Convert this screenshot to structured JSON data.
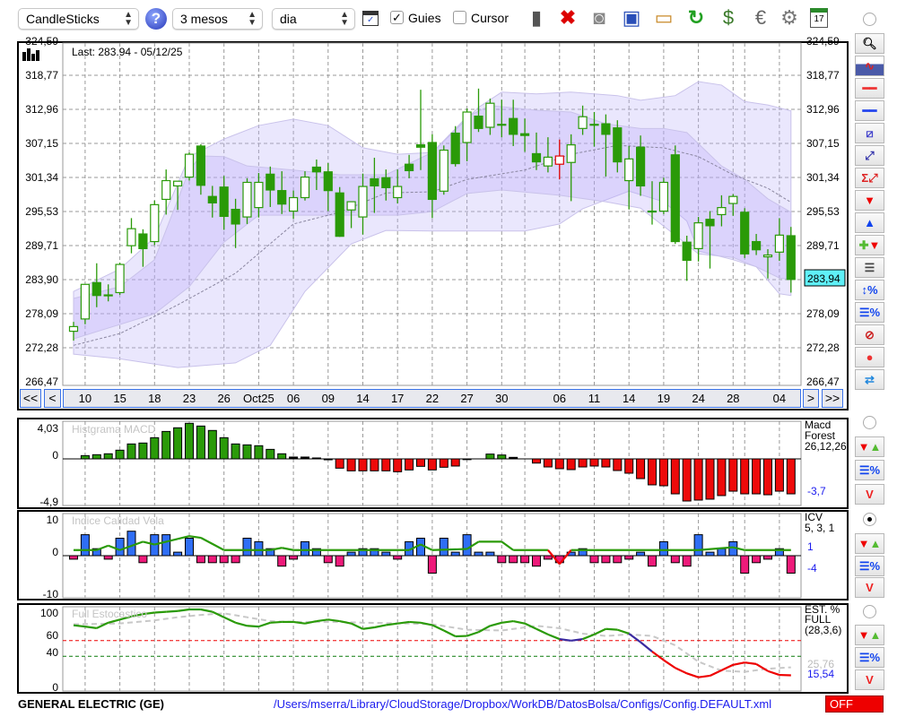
{
  "toolbar": {
    "chart_type": "CandleSticks",
    "period": "3 mesos",
    "interval": "dia",
    "guides_label": "Guies",
    "guides_checked": true,
    "cursor_label": "Cursor",
    "cursor_checked": false,
    "icons": [
      "help-icon",
      "chart-window-icon",
      "trash-icon",
      "delete-icon",
      "lightbulb-icon",
      "save-icon",
      "open-folder-icon",
      "refresh-icon",
      "sync-dollar-icon",
      "euro-icon",
      "settings-icon",
      "calendar-icon"
    ],
    "calendar_day": "17"
  },
  "main": {
    "last_label": "Last: 283.94 - 05/12/25",
    "price_badge": "283,94",
    "y_labels": [
      "324,59",
      "318,77",
      "312,96",
      "307,15",
      "301,34",
      "295,53",
      "289,71",
      "283,90",
      "278,09",
      "272,28",
      "266,47"
    ],
    "nav": {
      "first": "<<",
      "prev": "<",
      "next": ">",
      "last": ">>"
    },
    "x_labels": [
      {
        "i": 2,
        "t": "10"
      },
      {
        "i": 5,
        "t": "15"
      },
      {
        "i": 8,
        "t": "18"
      },
      {
        "i": 11,
        "t": "23"
      },
      {
        "i": 14,
        "t": "26"
      },
      {
        "i": 17,
        "t": "Oct25"
      },
      {
        "i": 20,
        "t": "06"
      },
      {
        "i": 23,
        "t": "09"
      },
      {
        "i": 26,
        "t": "14"
      },
      {
        "i": 29,
        "t": "17"
      },
      {
        "i": 32,
        "t": "22"
      },
      {
        "i": 35,
        "t": "27"
      },
      {
        "i": 38,
        "t": "30"
      },
      {
        "i": 43,
        "t": "06"
      },
      {
        "i": 46,
        "t": "11"
      },
      {
        "i": 49,
        "t": "14"
      },
      {
        "i": 52,
        "t": "19"
      },
      {
        "i": 55,
        "t": "24"
      },
      {
        "i": 58,
        "t": "28"
      },
      {
        "i": 62,
        "t": "04"
      }
    ],
    "extra_grid": [
      40,
      59
    ]
  },
  "chart_data": [
    {
      "type": "candlestick",
      "title": "GENERAL ELECTRIC (GE)",
      "ylim": [
        266.47,
        324.59
      ],
      "special_red_index": 43,
      "ohlc": [
        [
          275.1,
          276.7,
          273.5,
          275.9
        ],
        [
          277.2,
          283.1,
          276.3,
          283.1
        ],
        [
          283.4,
          286.7,
          279.2,
          281.2
        ],
        [
          281.3,
          283.1,
          280.2,
          281.3
        ],
        [
          281.7,
          286.8,
          281.3,
          286.5
        ],
        [
          289.7,
          294.4,
          288.4,
          292.6
        ],
        [
          291.7,
          292.5,
          286.1,
          289.2
        ],
        [
          290.4,
          297.4,
          289.8,
          296.7
        ],
        [
          297.6,
          302.7,
          295.0,
          300.8
        ],
        [
          299.9,
          300.7,
          295.8,
          300.7
        ],
        [
          301.4,
          305.6,
          300.8,
          305.3
        ],
        [
          306.7,
          307.0,
          298.4,
          300.0
        ],
        [
          298.1,
          299.9,
          294.5,
          297.0
        ],
        [
          299.7,
          301.6,
          292.4,
          294.7
        ],
        [
          295.9,
          297.7,
          289.3,
          293.4
        ],
        [
          294.6,
          301.2,
          293.4,
          300.5
        ],
        [
          296.2,
          302.1,
          294.5,
          300.5
        ],
        [
          301.9,
          303.2,
          296.3,
          299.2
        ],
        [
          299.1,
          302.4,
          295.1,
          296.8
        ],
        [
          295.6,
          299.1,
          294.3,
          297.9
        ],
        [
          297.9,
          302.4,
          297.4,
          301.4
        ],
        [
          303.1,
          304.4,
          299.2,
          302.3
        ],
        [
          302.3,
          303.8,
          295.6,
          299.1
        ],
        [
          298.7,
          299.7,
          291.2,
          291.3
        ],
        [
          295.8,
          297.2,
          292.7,
          297.2
        ],
        [
          294.6,
          302.0,
          291.6,
          299.8
        ],
        [
          301.1,
          304.7,
          295.3,
          299.9
        ],
        [
          301.3,
          302.7,
          297.4,
          299.6
        ],
        [
          297.9,
          302.7,
          296.9,
          299.8
        ],
        [
          303.6,
          305.2,
          301.2,
          302.5
        ],
        [
          306.9,
          316.3,
          302.6,
          306.5
        ],
        [
          307.3,
          308.7,
          294.4,
          297.6
        ],
        [
          299.0,
          306.8,
          298.4,
          306.0
        ],
        [
          308.9,
          310.1,
          303.2,
          303.7
        ],
        [
          307.3,
          313.1,
          304.1,
          312.5
        ],
        [
          311.8,
          316.5,
          309.1,
          309.7
        ],
        [
          309.9,
          314.8,
          308.6,
          314.0
        ],
        [
          310.4,
          314.6,
          308.2,
          310.4
        ],
        [
          311.4,
          314.6,
          306.7,
          308.7
        ],
        [
          308.8,
          311.4,
          305.7,
          308.5
        ],
        [
          305.4,
          309.0,
          302.6,
          304.0
        ],
        [
          303.3,
          308.2,
          302.2,
          304.8
        ],
        [
          303.6,
          307.8,
          301.0,
          305.0
        ],
        [
          303.9,
          308.7,
          297.3,
          306.9
        ],
        [
          309.7,
          313.6,
          308.6,
          311.7
        ],
        [
          310.4,
          312.5,
          306.6,
          310.4
        ],
        [
          310.5,
          312.1,
          301.5,
          308.7
        ],
        [
          309.8,
          311.1,
          302.2,
          304.0
        ],
        [
          300.8,
          306.7,
          295.9,
          304.5
        ],
        [
          306.5,
          308.5,
          298.2,
          299.9
        ],
        [
          295.6,
          300.7,
          293.3,
          295.6
        ],
        [
          295.6,
          301.3,
          295.1,
          300.5
        ],
        [
          305.2,
          306.8,
          290.0,
          290.4
        ],
        [
          290.3,
          291.4,
          283.7,
          287.2
        ],
        [
          289.2,
          294.6,
          287.0,
          293.6
        ],
        [
          294.2,
          295.6,
          285.8,
          293.1
        ],
        [
          295.0,
          298.3,
          293.0,
          296.2
        ],
        [
          296.9,
          298.5,
          294.8,
          298.1
        ],
        [
          295.4,
          296.1,
          287.6,
          288.3
        ],
        [
          290.4,
          291.7,
          288.1,
          289.0
        ],
        [
          287.8,
          289.1,
          284.1,
          288.1
        ],
        [
          288.6,
          294.4,
          287.1,
          291.5
        ],
        [
          291.4,
          292.9,
          281.7,
          283.94
        ]
      ],
      "outer_upper": [
        [
          1,
          281.9
        ],
        [
          5,
          285.7
        ],
        [
          8,
          291.1
        ],
        [
          11,
          304.9
        ],
        [
          14,
          307.9
        ],
        [
          17,
          310.2
        ],
        [
          20,
          311.3
        ],
        [
          23,
          310.2
        ],
        [
          26,
          306.4
        ],
        [
          29,
          305.3
        ],
        [
          32,
          305.6
        ],
        [
          36,
          313.3
        ],
        [
          38,
          315.9
        ],
        [
          41,
          315.6
        ],
        [
          44,
          315.9
        ],
        [
          48,
          315.3
        ],
        [
          50,
          314.5
        ],
        [
          53,
          315.3
        ],
        [
          55,
          317.7
        ],
        [
          57,
          317.1
        ],
        [
          59,
          314.3
        ],
        [
          61,
          313.7
        ],
        [
          63,
          312.7
        ]
      ],
      "outer_lower": [
        [
          1,
          271.2
        ],
        [
          5,
          270.4
        ],
        [
          10,
          268.9
        ],
        [
          15,
          269.7
        ],
        [
          18,
          272.7
        ],
        [
          21,
          281.9
        ],
        [
          25,
          290.0
        ],
        [
          28,
          292.3
        ],
        [
          32,
          292.2
        ],
        [
          36,
          292.2
        ],
        [
          40,
          292.2
        ],
        [
          43,
          293.4
        ],
        [
          45,
          296.0
        ],
        [
          49,
          299.0
        ],
        [
          52,
          297.2
        ],
        [
          54,
          293.9
        ],
        [
          55,
          288.8
        ],
        [
          58,
          287.3
        ],
        [
          60,
          286.1
        ],
        [
          62,
          281.5
        ],
        [
          63,
          281.2
        ]
      ],
      "inner_upper": [
        [
          1,
          280.7
        ],
        [
          5,
          282.7
        ],
        [
          8,
          287.3
        ],
        [
          11,
          302.6
        ],
        [
          12,
          305.0
        ],
        [
          14,
          304.9
        ],
        [
          16,
          303.3
        ],
        [
          20,
          302.6
        ],
        [
          24,
          301.8
        ],
        [
          28,
          301.8
        ],
        [
          32,
          305.6
        ],
        [
          35,
          311.7
        ],
        [
          37,
          313.6
        ],
        [
          41,
          312.8
        ],
        [
          44,
          312.5
        ],
        [
          47,
          310.5
        ],
        [
          50,
          309.7
        ],
        [
          52,
          309.7
        ],
        [
          54,
          309.0
        ],
        [
          57,
          303.3
        ],
        [
          59,
          301.0
        ],
        [
          61,
          297.7
        ],
        [
          63,
          295.4
        ]
      ],
      "inner_lower": [
        [
          1,
          273.8
        ],
        [
          8,
          278.1
        ],
        [
          11,
          282.7
        ],
        [
          14,
          290.3
        ],
        [
          17,
          294.9
        ],
        [
          21,
          294.9
        ],
        [
          25,
          294.9
        ],
        [
          29,
          294.9
        ],
        [
          32,
          295.5
        ],
        [
          35,
          298.6
        ],
        [
          38,
          299.2
        ],
        [
          43,
          298.3
        ],
        [
          47,
          297.2
        ],
        [
          50,
          296.1
        ],
        [
          53,
          291.5
        ],
        [
          55,
          288.3
        ],
        [
          58,
          287.7
        ],
        [
          60,
          286.1
        ],
        [
          62,
          284.2
        ],
        [
          63,
          283.9
        ]
      ],
      "moving_average": [
        [
          1,
          272.7
        ],
        [
          5,
          274.7
        ],
        [
          10,
          279.6
        ],
        [
          15,
          285.0
        ],
        [
          20,
          293.4
        ],
        [
          24,
          295.4
        ],
        [
          28,
          298.7
        ],
        [
          32,
          298.9
        ],
        [
          35,
          301.0
        ],
        [
          40,
          302.6
        ],
        [
          44,
          305.3
        ],
        [
          48,
          306.8
        ],
        [
          52,
          306.4
        ],
        [
          55,
          304.9
        ],
        [
          58,
          301.8
        ],
        [
          61,
          299.5
        ],
        [
          63,
          297.1
        ]
      ]
    },
    {
      "type": "bar",
      "title": "Histgrama MACD",
      "ylim": [
        -4.9,
        4.03
      ],
      "y_labels": [
        "4,03",
        "0",
        "-4,9"
      ],
      "legend": [
        "Macd",
        "Forest",
        "26,12,26"
      ],
      "last_value": "-3,7",
      "values": [
        0,
        0.43,
        0.55,
        0.67,
        1.14,
        1.96,
        2.08,
        2.78,
        3.6,
        4.08,
        4.67,
        4.31,
        3.73,
        2.78,
        1.96,
        1.84,
        1.73,
        1.25,
        0.67,
        0.24,
        0.24,
        0.12,
        -0.12,
        -1.22,
        -1.57,
        -1.57,
        -1.57,
        -1.57,
        -1.69,
        -1.45,
        -0.98,
        -1.45,
        -1.1,
        -0.94,
        -0.1,
        0,
        0.63,
        0.51,
        0.2,
        0,
        -0.55,
        -1.06,
        -1.29,
        -1.41,
        -1.06,
        -0.94,
        -1.06,
        -1.53,
        -1.88,
        -2.59,
        -3.41,
        -3.53,
        -4.59,
        -5.53,
        -5.41,
        -5.29,
        -4.82,
        -4.24,
        -4.59,
        -4.59,
        -4.71,
        -4.24,
        -4.59
      ]
    },
    {
      "type": "bar",
      "title": "Indice Calidad Vela",
      "ylim": [
        -10,
        10
      ],
      "y_labels": [
        "10",
        "0",
        "-10"
      ],
      "legend": [
        "ICV",
        "5, 3, 1"
      ],
      "value_1": "1",
      "value_2": "-4",
      "values": [
        -1,
        6,
        2,
        -1,
        5,
        7,
        -2,
        6,
        6,
        1,
        5,
        -2,
        -2,
        -2,
        -2,
        5,
        4,
        2,
        -3,
        -1,
        4,
        2,
        -2,
        -3,
        1,
        2,
        2,
        1,
        -1,
        4,
        5,
        -5,
        5,
        1,
        6,
        1,
        1,
        -2,
        -2,
        -2,
        -3,
        -1,
        -2,
        1,
        2,
        -2,
        -2,
        -2,
        -1,
        1,
        -3,
        4,
        -2,
        -3,
        6,
        1,
        2,
        4,
        -5,
        -2,
        -1,
        2,
        -5
      ],
      "signal": [
        [
          1,
          1
        ],
        [
          3,
          1
        ],
        [
          4,
          1.8
        ],
        [
          5,
          1
        ],
        [
          7,
          2.5
        ],
        [
          8,
          2
        ],
        [
          10,
          3
        ],
        [
          11,
          3.5
        ],
        [
          12,
          3.2
        ],
        [
          14,
          1
        ],
        [
          18,
          1
        ],
        [
          19,
          1.4
        ],
        [
          20,
          1
        ],
        [
          30,
          1
        ],
        [
          31,
          2
        ],
        [
          32,
          1
        ],
        [
          35,
          1.2
        ],
        [
          36,
          2.5
        ],
        [
          38,
          2.5
        ],
        [
          39,
          1
        ],
        [
          42,
          1
        ],
        [
          43,
          -1.5
        ],
        [
          44,
          1
        ],
        [
          55,
          1
        ],
        [
          58,
          1.5
        ],
        [
          59,
          1
        ],
        [
          63,
          1
        ]
      ]
    },
    {
      "type": "line",
      "title": "Full Estocastico",
      "ylim": [
        0,
        100
      ],
      "y_labels": [
        "100",
        "60",
        "40",
        "0"
      ],
      "levels": [
        60,
        40
      ],
      "legend": [
        "EST. %",
        "FULL",
        "(28,3,6)"
      ],
      "d_value": "25,76",
      "k_value": "15,54",
      "k": [
        79.7,
        78,
        76,
        83,
        87,
        91,
        94,
        96,
        97,
        98,
        100,
        100,
        97,
        90,
        83,
        79,
        78,
        83,
        84,
        84,
        82,
        85,
        87,
        85,
        82,
        75,
        77,
        80,
        82,
        84,
        83,
        80,
        73,
        65.5,
        66,
        71,
        79,
        83,
        85,
        82,
        75,
        68,
        62,
        60,
        62,
        68,
        75,
        74,
        69,
        58,
        46,
        35,
        25,
        18,
        13,
        15,
        22,
        29,
        32,
        30,
        21,
        16,
        15.54
      ],
      "d": [
        [
          1,
          81
        ],
        [
          5,
          82
        ],
        [
          8,
          86
        ],
        [
          10,
          90
        ],
        [
          12,
          93
        ],
        [
          14,
          95
        ],
        [
          16,
          90
        ],
        [
          18,
          85
        ],
        [
          20,
          84
        ],
        [
          24,
          84
        ],
        [
          26,
          83
        ],
        [
          30,
          82
        ],
        [
          32,
          81
        ],
        [
          35,
          74
        ],
        [
          38,
          73
        ],
        [
          41,
          79
        ],
        [
          43,
          76
        ],
        [
          45,
          69
        ],
        [
          47,
          66
        ],
        [
          49,
          68
        ],
        [
          51,
          66
        ],
        [
          53,
          54
        ],
        [
          55,
          33
        ],
        [
          57,
          21.5
        ],
        [
          59,
          20
        ],
        [
          61,
          24
        ],
        [
          63,
          25.76
        ]
      ]
    }
  ],
  "footer": {
    "symbol": "GENERAL ELECTRIC (GE)",
    "config_path": "/Users/mserra/Library/CloudStorage/Dropbox/WorkDB/DatosBolsa/Configs/Config.DEFAULT.xml",
    "status": "OFF"
  },
  "colors": {
    "up_fill": "#ffffff",
    "candle": "#2a9a08",
    "special": "#e00000",
    "pos_bar": "#2a9a08",
    "neg_bar": "#ee0a0a",
    "icv_pos": "#2f6ef5",
    "icv_neg": "#ee1a7a",
    "badge": "#5ff0f8",
    "status": "#ee0000"
  }
}
